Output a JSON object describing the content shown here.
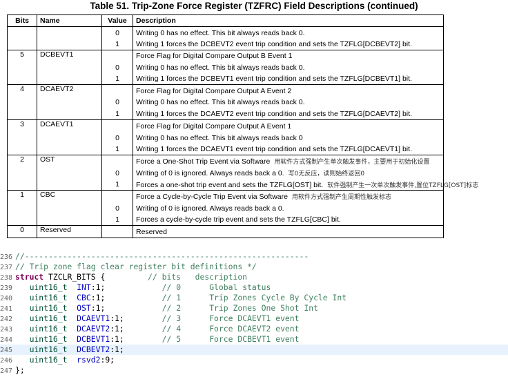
{
  "title": "Table 51. Trip-Zone Force Register (TZFRC) Field Descriptions (continued)",
  "headers": {
    "bits": "Bits",
    "name": "Name",
    "value": "Value",
    "desc": "Description"
  },
  "groups": [
    {
      "bits": "",
      "name": "",
      "lines": [
        {
          "value": "0",
          "desc": "Writing 0 has no effect. This bit always reads back 0.",
          "note": ""
        },
        {
          "value": "1",
          "desc": "Writing 1 forces the DCBEVT2 event trip condition and sets the TZFLG[DCBEVT2] bit.",
          "note": ""
        }
      ]
    },
    {
      "bits": "5",
      "name": "DCBEVT1",
      "lines": [
        {
          "value": "",
          "desc": "Force Flag for Digital Compare Output B Event 1",
          "note": ""
        },
        {
          "value": "0",
          "desc": "Writing 0 has no effect. This bit always reads back 0.",
          "note": ""
        },
        {
          "value": "1",
          "desc": "Writing 1 forces the DCBEVT1 event trip condition and sets the TZFLG[DCBEVT1] bit.",
          "note": ""
        }
      ]
    },
    {
      "bits": "4",
      "name": "DCAEVT2",
      "lines": [
        {
          "value": "",
          "desc": "Force Flag for Digital Compare Output A Event 2",
          "note": ""
        },
        {
          "value": "0",
          "desc": "Writing 0 has no effect. This bit always reads back 0.",
          "note": ""
        },
        {
          "value": "1",
          "desc": "Writing 1 forces the DCAEVT2 event trip condition and sets the TZFLG[DCAEVT2] bit.",
          "note": ""
        }
      ]
    },
    {
      "bits": "3",
      "name": "DCAEVT1",
      "lines": [
        {
          "value": "",
          "desc": "Force Flag for Digital Compare Output A Event 1",
          "note": ""
        },
        {
          "value": "0",
          "desc": "Writing 0 has no effect. This bit always reads back 0",
          "note": ""
        },
        {
          "value": "1",
          "desc": "Writing 1 forces the DCAEVT1 event trip condition and sets the TZFLG[DCAEVT1] bit.",
          "note": ""
        }
      ]
    },
    {
      "bits": "2",
      "name": "OST",
      "lines": [
        {
          "value": "",
          "desc": "Force a One-Shot Trip Event via Software",
          "note": "用软件方式强制产生单次触发事件，主要用于初始化设置"
        },
        {
          "value": "0",
          "desc": "Writing of 0 is ignored. Always reads back a 0.",
          "note": "写0无反应，读则始终返回0"
        },
        {
          "value": "1",
          "desc": "Forces a one-shot trip event and sets the TZFLG[OST] bit.",
          "note": "软件强制产生一次单次触发事件,置位TZFLG[OST]标志"
        }
      ]
    },
    {
      "bits": "1",
      "name": "CBC",
      "lines": [
        {
          "value": "",
          "desc": "Force a Cycle-by-Cycle Trip Event via Software",
          "note": "用软件方式强制产生周期性触发标志"
        },
        {
          "value": "0",
          "desc": "Writing of 0 is ignored. Always reads back a 0.",
          "note": ""
        },
        {
          "value": "1",
          "desc": "Forces a cycle-by-cycle trip event and sets the TZFLG[CBC] bit.",
          "note": ""
        }
      ]
    },
    {
      "bits": "0",
      "name": "Reserved",
      "lines": [
        {
          "value": "",
          "desc": "Reserved",
          "note": ""
        }
      ]
    }
  ],
  "code": [
    {
      "ln": "236",
      "text": "//------------------------------------------------------------",
      "hl": false
    },
    {
      "ln": "237",
      "text": "// Trip zone flag clear register bit definitions */",
      "hl": false
    },
    {
      "ln": "238",
      "text": "struct TZCLR_BITS {         // bits   description",
      "hl": false
    },
    {
      "ln": "239",
      "text": "   uint16_t  INT:1;            // 0      Global status",
      "hl": false
    },
    {
      "ln": "240",
      "text": "   uint16_t  CBC:1;            // 1      Trip Zones Cycle By Cycle Int",
      "hl": false
    },
    {
      "ln": "241",
      "text": "   uint16_t  OST:1;            // 2      Trip Zones One Shot Int",
      "hl": false
    },
    {
      "ln": "242",
      "text": "   uint16_t  DCAEVT1:1;        // 3      Force DCAEVT1 event",
      "hl": false
    },
    {
      "ln": "243",
      "text": "   uint16_t  DCAEVT2:1;        // 4      Force DCAEVT2 event",
      "hl": false
    },
    {
      "ln": "244",
      "text": "   uint16_t  DCBEVT1:1;        // 5      Force DCBEVT1 event",
      "hl": false
    },
    {
      "ln": "245",
      "text": "   uint16_t  DCBEVT2:1;",
      "hl": true
    },
    {
      "ln": "246",
      "text": "   uint16_t  rsvd2:9;",
      "hl": false
    },
    {
      "ln": "247",
      "text": "};",
      "hl": false
    }
  ]
}
